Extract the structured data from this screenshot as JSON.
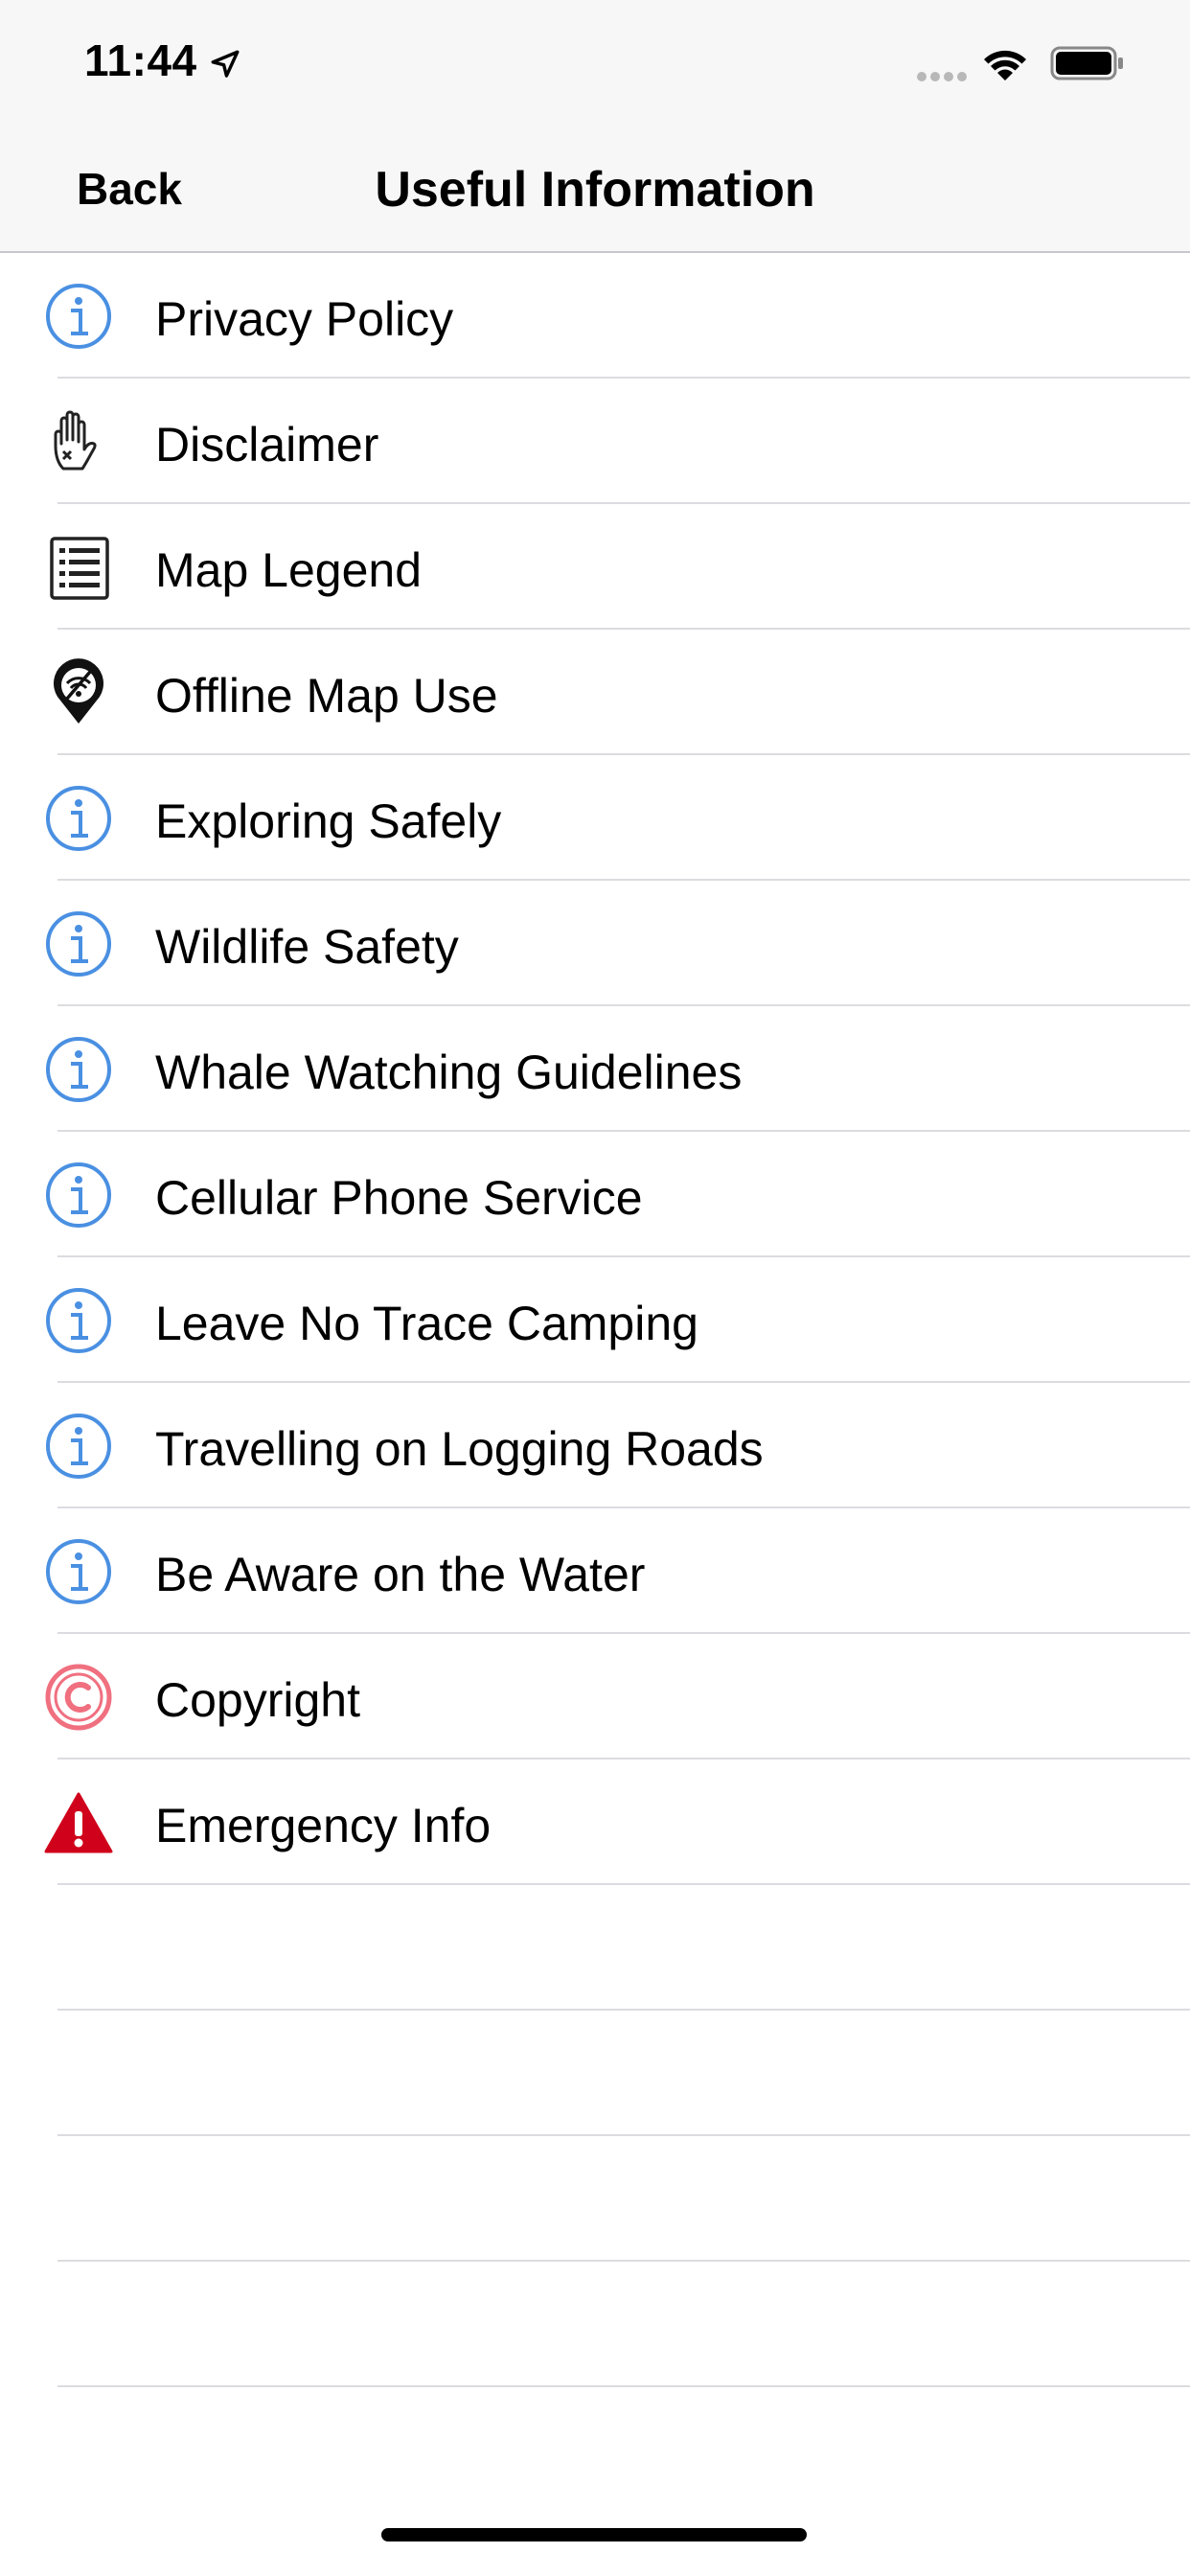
{
  "status_bar": {
    "time": "11:44"
  },
  "nav": {
    "back_label": "Back",
    "title": "Useful Information"
  },
  "items": [
    {
      "label": "Privacy Policy",
      "icon": "info-icon"
    },
    {
      "label": "Disclaimer",
      "icon": "hand-stop-icon"
    },
    {
      "label": "Map Legend",
      "icon": "list-icon"
    },
    {
      "label": "Offline Map Use",
      "icon": "offline-map-pin-icon"
    },
    {
      "label": "Exploring Safely",
      "icon": "info-icon"
    },
    {
      "label": "Wildlife Safety",
      "icon": "info-icon"
    },
    {
      "label": "Whale Watching Guidelines",
      "icon": "info-icon"
    },
    {
      "label": "Cellular Phone Service",
      "icon": "info-icon"
    },
    {
      "label": "Leave No Trace Camping",
      "icon": "info-icon"
    },
    {
      "label": "Travelling on Logging Roads",
      "icon": "info-icon"
    },
    {
      "label": "Be Aware on the Water",
      "icon": "info-icon"
    },
    {
      "label": "Copyright",
      "icon": "copyright-icon"
    },
    {
      "label": "Emergency Info",
      "icon": "warning-icon"
    }
  ],
  "colors": {
    "info_blue": "#4a90e2",
    "copyright_red": "#f07080",
    "warning_red": "#d0021b",
    "separator": "#dcdce0",
    "bar_background": "#f7f7f7"
  }
}
